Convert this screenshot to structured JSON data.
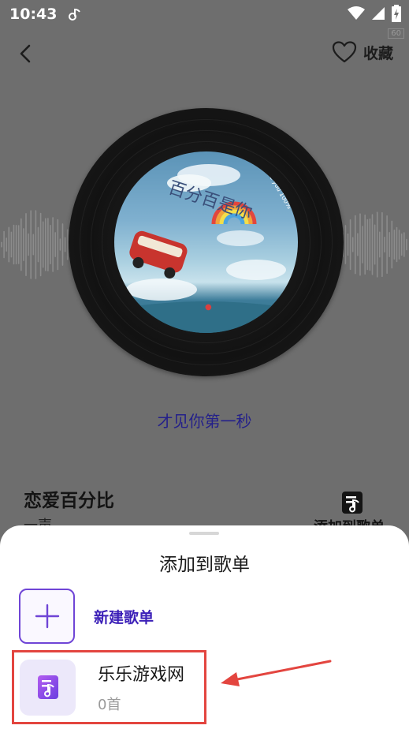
{
  "status_bar": {
    "time": "10:43",
    "fps": "60"
  },
  "header": {
    "favorite_label": "收藏"
  },
  "player": {
    "lyric": "才见你第一秒",
    "song_title": "恋爱百分比",
    "artist": "一声",
    "add_to_playlist_label": "添加到歌单"
  },
  "cover_art": {
    "text_main": "百分百是你",
    "text_side": "Love you 100%"
  },
  "sheet": {
    "title": "添加到歌单",
    "new_playlist_label": "新建歌单",
    "playlists": [
      {
        "name": "乐乐游戏网",
        "count": "0首"
      }
    ]
  },
  "colors": {
    "accent": "#6f45d6",
    "highlight_box": "#e3453f",
    "lyric": "#24208a"
  }
}
